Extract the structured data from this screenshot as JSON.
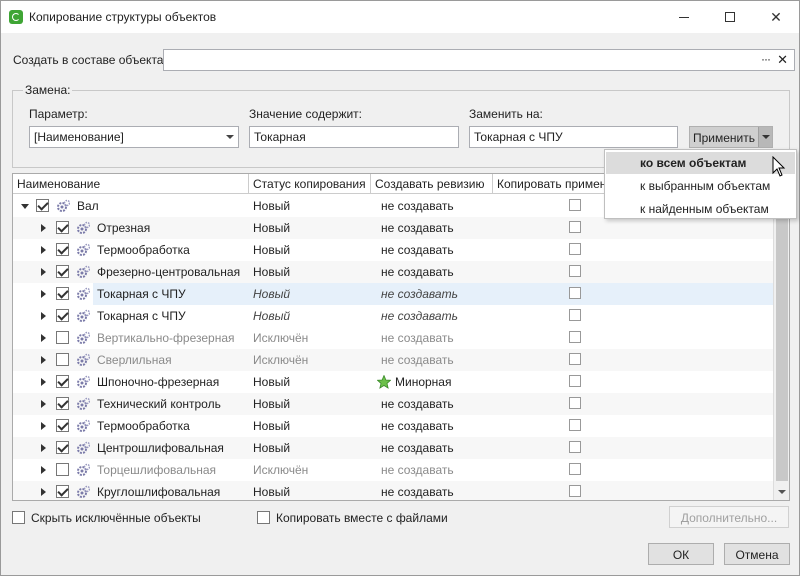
{
  "window": {
    "title": "Копирование структуры объектов"
  },
  "create": {
    "label": "Создать в составе объекта:",
    "value": "",
    "dots": "···",
    "clear": "✕"
  },
  "replace": {
    "legend": "Замена:",
    "param_label": "Параметр:",
    "param_value": "[Наименование]",
    "contains_label": "Значение содержит:",
    "contains_value": "Токарная",
    "replace_label": "Заменить на:",
    "replace_value": "Токарная с ЧПУ",
    "apply_label": "Применить"
  },
  "dropdown": {
    "items": [
      "ко всем объектам",
      "к выбранным объектам",
      "к найденным объектам"
    ],
    "active_index": 0
  },
  "grid": {
    "columns": [
      "Наименование",
      "Статус копирования",
      "Создавать ревизию",
      "Копировать примен"
    ],
    "rows": [
      {
        "name": "Вал",
        "status": "Новый",
        "revision": "не создавать",
        "checked": true,
        "level": 0,
        "excluded": false,
        "italic": false,
        "highlight": false,
        "star": false
      },
      {
        "name": "Отрезная",
        "status": "Новый",
        "revision": "не создавать",
        "checked": true,
        "level": 1,
        "excluded": false,
        "italic": false,
        "highlight": false,
        "star": false
      },
      {
        "name": "Термообработка",
        "status": "Новый",
        "revision": "не создавать",
        "checked": true,
        "level": 1,
        "excluded": false,
        "italic": false,
        "highlight": false,
        "star": false
      },
      {
        "name": "Фрезерно-центровальная",
        "status": "Новый",
        "revision": "не создавать",
        "checked": true,
        "level": 1,
        "excluded": false,
        "italic": false,
        "highlight": false,
        "star": false
      },
      {
        "name": "Токарная с ЧПУ",
        "status": "Новый",
        "revision": "не создавать",
        "checked": true,
        "level": 1,
        "excluded": false,
        "italic": true,
        "highlight": true,
        "star": false
      },
      {
        "name": "Токарная с ЧПУ",
        "status": "Новый",
        "revision": "не создавать",
        "checked": true,
        "level": 1,
        "excluded": false,
        "italic": true,
        "highlight": false,
        "star": false
      },
      {
        "name": "Вертикально-фрезерная",
        "status": "Исключён",
        "revision": "не создавать",
        "checked": false,
        "level": 1,
        "excluded": true,
        "italic": false,
        "highlight": false,
        "star": false
      },
      {
        "name": "Сверлильная",
        "status": "Исключён",
        "revision": "не создавать",
        "checked": false,
        "level": 1,
        "excluded": true,
        "italic": false,
        "highlight": false,
        "star": false
      },
      {
        "name": "Шпоночно-фрезерная",
        "status": "Новый",
        "revision": "Минорная",
        "checked": true,
        "level": 1,
        "excluded": false,
        "italic": false,
        "highlight": false,
        "star": true
      },
      {
        "name": "Технический контроль",
        "status": "Новый",
        "revision": "не создавать",
        "checked": true,
        "level": 1,
        "excluded": false,
        "italic": false,
        "highlight": false,
        "star": false
      },
      {
        "name": "Термообработка",
        "status": "Новый",
        "revision": "не создавать",
        "checked": true,
        "level": 1,
        "excluded": false,
        "italic": false,
        "highlight": false,
        "star": false
      },
      {
        "name": "Центрошлифовальная",
        "status": "Новый",
        "revision": "не создавать",
        "checked": true,
        "level": 1,
        "excluded": false,
        "italic": false,
        "highlight": false,
        "star": false
      },
      {
        "name": "Торцешлифовальная",
        "status": "Исключён",
        "revision": "не создавать",
        "checked": false,
        "level": 1,
        "excluded": true,
        "italic": false,
        "highlight": false,
        "star": false
      },
      {
        "name": "Круглошлифовальная",
        "status": "Новый",
        "revision": "не создавать",
        "checked": true,
        "level": 1,
        "excluded": false,
        "italic": false,
        "highlight": false,
        "star": false
      }
    ]
  },
  "footer": {
    "hide_excluded": "Скрыть исключённые объекты",
    "copy_with_files": "Копировать вместе с файлами",
    "advanced": "Дополнительно...",
    "ok": "ОК",
    "cancel": "Отмена"
  },
  "colors": {
    "accent": "#3fa535",
    "highlight": "#e6f0fa",
    "star": "#5cb85c"
  }
}
